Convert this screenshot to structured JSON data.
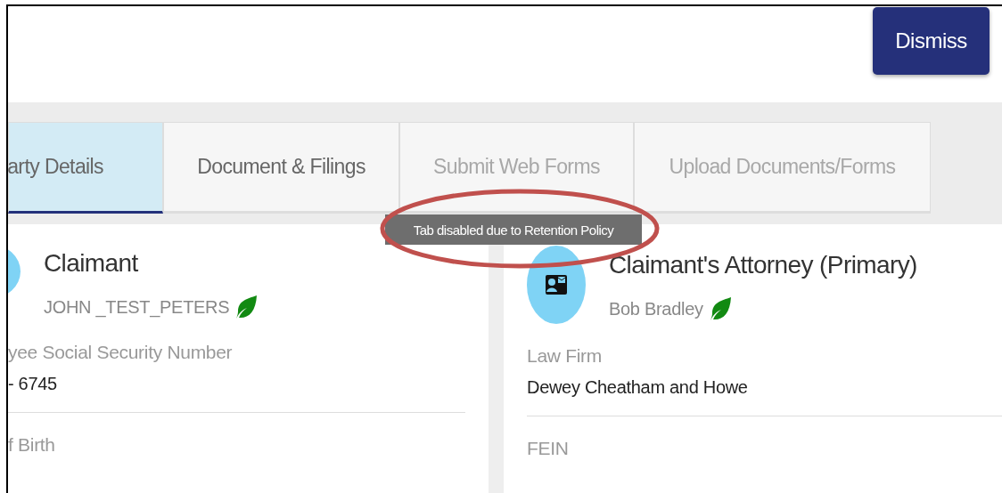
{
  "header": {
    "dismiss_button": "Dismiss"
  },
  "tabs": [
    {
      "label": "arty Details",
      "selected": true,
      "disabled": false
    },
    {
      "label": "Document & Filings",
      "selected": false,
      "disabled": false
    },
    {
      "label": "Submit Web Forms",
      "selected": false,
      "disabled": true
    },
    {
      "label": "Upload Documents/Forms",
      "selected": false,
      "disabled": true
    }
  ],
  "tooltip": {
    "text": "Tab disabled due to Retention Policy"
  },
  "cards": [
    {
      "title": "Claimant",
      "name": "JOHN _TEST_PETERS",
      "fields": [
        {
          "label": "yee Social Security Number",
          "value": "- 6745"
        },
        {
          "label": "f Birth"
        }
      ]
    },
    {
      "title": "Claimant's Attorney (Primary)",
      "name": "Bob Bradley",
      "fields": [
        {
          "label": "Law Firm",
          "value": "Dewey Cheatham and Howe"
        },
        {
          "label": "FEIN"
        }
      ]
    }
  ]
}
